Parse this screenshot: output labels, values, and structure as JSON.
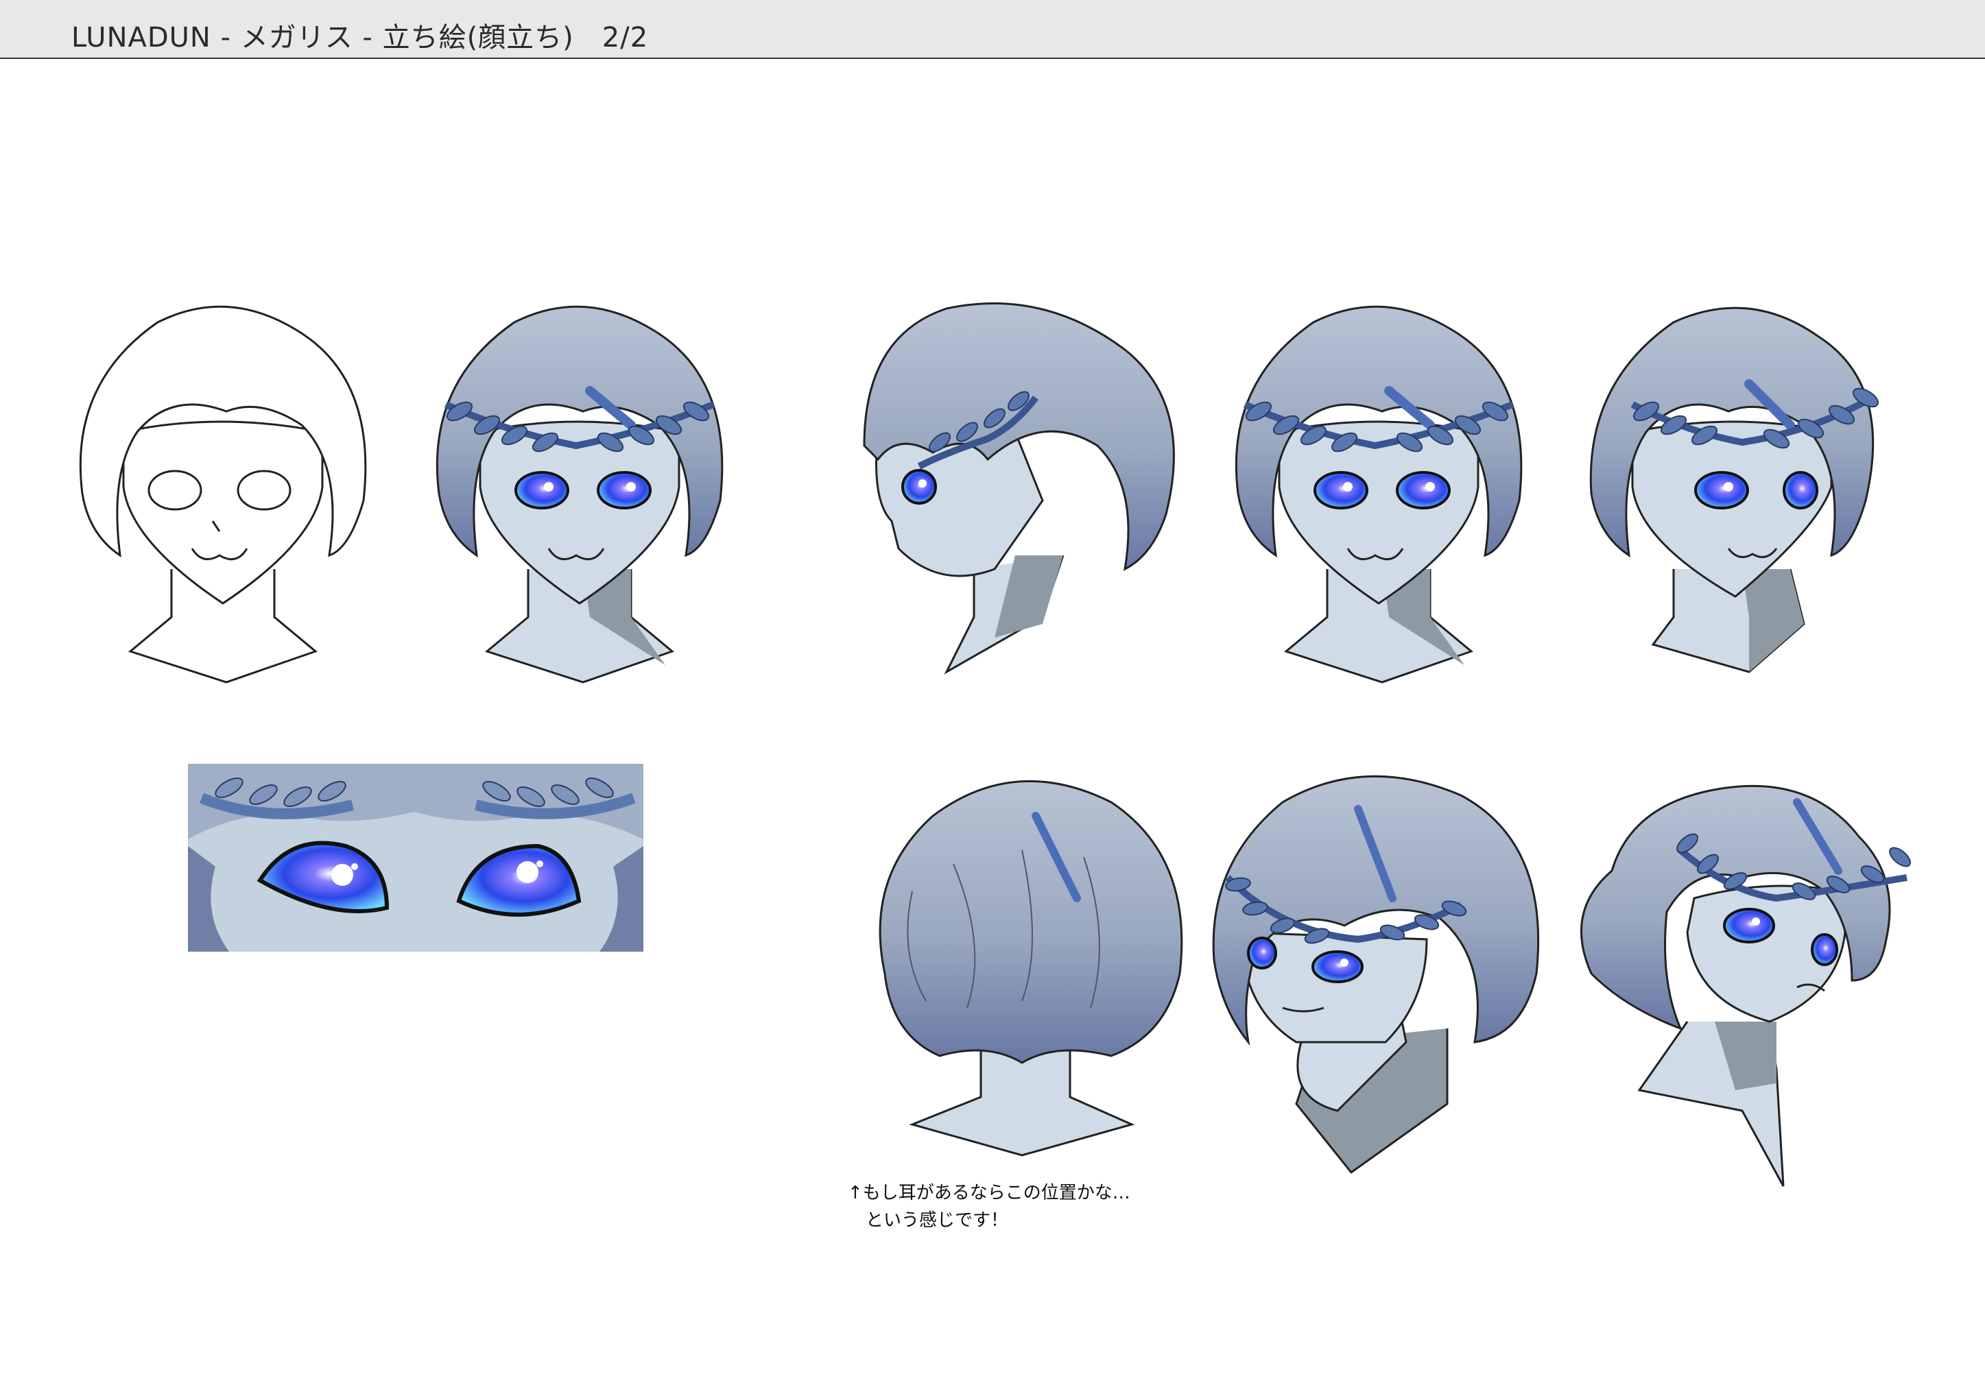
{
  "header": {
    "title": "LUNADUN - メガリス - 立ち絵(顔立ち)　2/2"
  },
  "note": {
    "line1": "↑もし耳があるならこの位置かな…",
    "line2": "　という感じです！"
  },
  "colors": {
    "skin": "#cfdce7",
    "hair": "#a2b0c5",
    "hair_shadow": "#6f7fa6",
    "hair_accent": "#4e6db8",
    "laurel": "#5a78b0",
    "eye": "#2f4fe0",
    "eye_glow": "#7fd0ff",
    "line": "#2a2a2a"
  },
  "views": [
    {
      "icon": "lineart-front-head-icon"
    },
    {
      "icon": "colored-front-head-icon"
    },
    {
      "icon": "profile-left-head-icon"
    },
    {
      "icon": "colored-front-head-icon"
    },
    {
      "icon": "three-quarter-right-head-icon"
    },
    {
      "icon": "back-view-head-icon"
    },
    {
      "icon": "tilted-down-head-icon"
    },
    {
      "icon": "tilted-up-head-icon"
    },
    {
      "icon": "eyes-closeup-icon"
    }
  ]
}
